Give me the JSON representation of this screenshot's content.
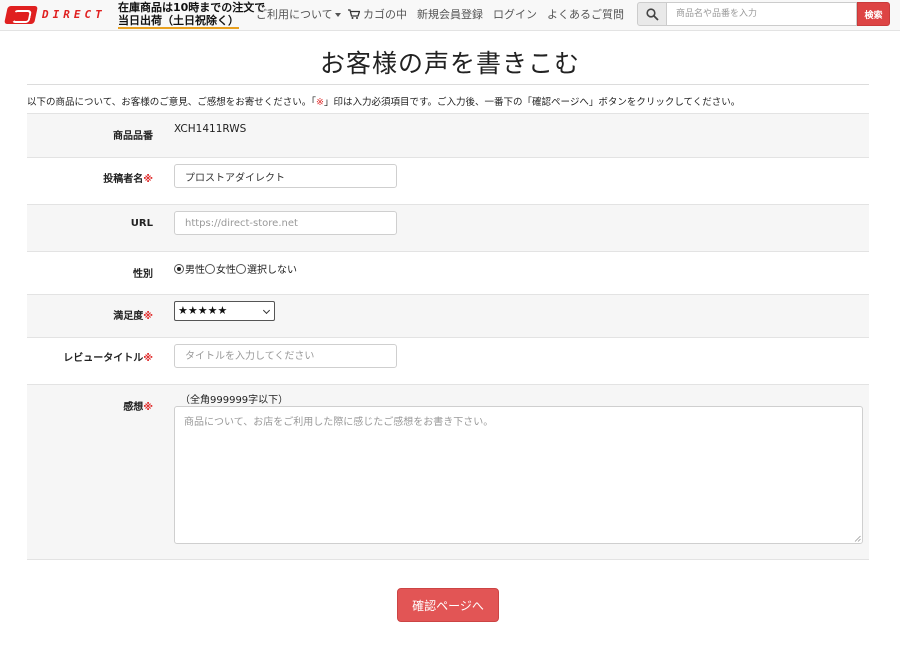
{
  "header": {
    "logo_text": "DIRECT",
    "notice_line1": "在庫商品は10時までの注文で",
    "notice_line2": "当日出荷（土日祝除く）",
    "nav": {
      "guide": "ご利用について",
      "cart": "カゴの中",
      "register": "新規会員登録",
      "login": "ログイン",
      "faq": "よくあるご質問"
    },
    "search": {
      "placeholder": "商品名や品番を入力",
      "button": "検索"
    }
  },
  "page": {
    "title": "お客様の声を書きこむ",
    "intro_before": "以下の商品について、お客様のご意見、ご感想をお寄せください。「",
    "intro_mark": "※",
    "intro_after": "」印は入力必須項目です。ご入力後、一番下の「確認ページへ」ボタンをクリックしてください。"
  },
  "form": {
    "required_mark": "※",
    "product_code": {
      "label": "商品品番",
      "value": "XCH1411RWS"
    },
    "name": {
      "label": "投稿者名",
      "value": "プロストアダイレクト"
    },
    "url": {
      "label": "URL",
      "placeholder": "https://direct-store.net"
    },
    "gender": {
      "label": "性別",
      "options": [
        "男性",
        "女性",
        "選択しない"
      ],
      "selected": "男性"
    },
    "rating": {
      "label": "満足度",
      "value": "★★★★★"
    },
    "review_title": {
      "label": "レビュータイトル",
      "placeholder": "タイトルを入力してください"
    },
    "impression": {
      "label": "感想",
      "limit_note": "（全角999999字以下）",
      "placeholder": "商品について、お店をご利用した際に感じたご感想をお書き下さい。"
    },
    "submit": "確認ページへ"
  },
  "colors": {
    "accent_red": "#e25555",
    "required_red": "#e03030",
    "notice_underline": "#e8a020"
  }
}
